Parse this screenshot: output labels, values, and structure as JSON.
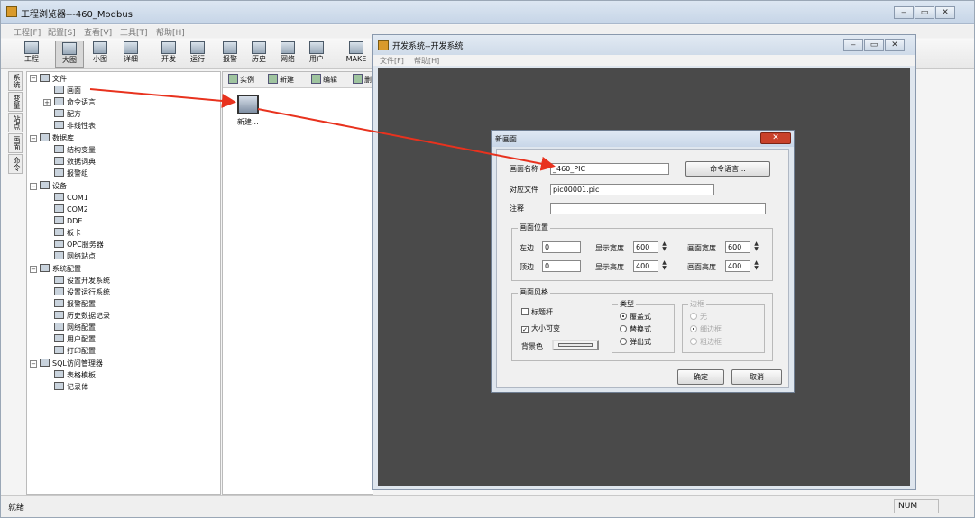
{
  "app": {
    "title": "工程浏览器---460_Modbus"
  },
  "menu": [
    "工程[F]",
    "配置[S]",
    "查看[V]",
    "工具[T]",
    "帮助[H]"
  ],
  "toolbar": [
    "工程",
    "大图",
    "小图",
    "详细",
    "开发",
    "运行",
    "报警",
    "历史",
    "网络",
    "用户",
    "MAKE"
  ],
  "side_tabs": [
    "系统",
    "变量",
    "站点",
    "画面",
    "命令"
  ],
  "tree": {
    "file": "文件",
    "picture": "画面",
    "cmd_lang": "命令语言",
    "recipe": "配方",
    "nonline_table": "非线性表",
    "database": "数据库",
    "struct_var": "结构变量",
    "data_dict": "数据词典",
    "alarm_group": "报警组",
    "device": "设备",
    "com1": "COM1",
    "com2": "COM2",
    "dde": "DDE",
    "board": "板卡",
    "opc": "OPC服务器",
    "net_station": "网络站点",
    "sys_config": "系统配置",
    "dev_sys": "设置开发系统",
    "run_sys": "设置运行系统",
    "alarm_cfg": "报警配置",
    "hist_rec": "历史数据记录",
    "net_cfg": "网络配置",
    "user_cfg": "用户配置",
    "print_cfg": "打印配置",
    "sql_mgr": "SQL访问管理器",
    "table_tpl": "表格模板",
    "record_set": "记录体"
  },
  "mid_toolbar": [
    "实例",
    "新建",
    "编辑",
    "删"
  ],
  "new_item": "新建...",
  "dev_window": {
    "title": "开发系统--开发系统",
    "menu": [
      "文件[F]",
      "帮助[H]"
    ]
  },
  "dialog": {
    "title": "新画面",
    "name_label": "画面名称",
    "name_value": "_460_PIC",
    "cmd_button": "命令语言...",
    "file_label": "对应文件",
    "file_value": "pic00001.pic",
    "note_label": "注释",
    "note_value": "",
    "position": {
      "legend": "画面位置",
      "left_label": "左边",
      "left_value": "0",
      "top_label": "顶边",
      "top_value": "0",
      "disp_w_label": "显示宽度",
      "disp_w_value": "600",
      "disp_h_label": "显示高度",
      "disp_h_value": "400",
      "pic_w_label": "画面宽度",
      "pic_w_value": "600",
      "pic_h_label": "画面高度",
      "pic_h_value": "400"
    },
    "style": {
      "legend": "画面风格",
      "titlebar": "标题杆",
      "titlebar_checked": false,
      "resizable": "大小可变",
      "resizable_checked": true,
      "bgcolor": "背景色",
      "type_legend": "类型",
      "type_options": [
        "覆盖式",
        "替换式",
        "弹出式"
      ],
      "type_selected": 0,
      "border_legend": "边框",
      "border_options": [
        "无",
        "细边框",
        "粗边框"
      ],
      "border_selected": 1
    },
    "ok": "确定",
    "cancel": "取消"
  },
  "status": {
    "left": "就绪",
    "num": "NUM"
  },
  "colors": {
    "accent_arrow": "#e8321e",
    "canvas": "#4a4a4a",
    "close_red": "#c9412a"
  }
}
